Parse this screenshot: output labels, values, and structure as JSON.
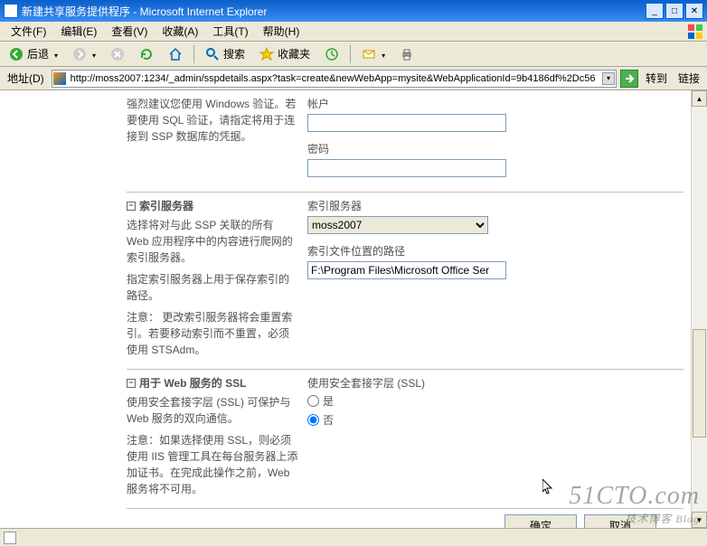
{
  "window": {
    "title": "新建共享服务提供程序 - Microsoft Internet Explorer",
    "min": "_",
    "max": "□",
    "close": "✕"
  },
  "menu": {
    "file": "文件(F)",
    "edit": "编辑(E)",
    "view": "查看(V)",
    "favorites": "收藏(A)",
    "tools": "工具(T)",
    "help": "帮助(H)"
  },
  "toolbar": {
    "back": "后退",
    "forward": "",
    "stop": "",
    "refresh": "",
    "home": "",
    "search": "搜索",
    "favorites": "收藏夹"
  },
  "addressbar": {
    "label": "地址(D)",
    "url": "http://moss2007:1234/_admin/sspdetails.aspx?task=create&newWebApp=mysite&WebApplicationId=9b4186df%2Dc56",
    "go": "转到",
    "links": "链接"
  },
  "sections": {
    "credential": {
      "text1": "强烈建议您使用 Windows 验证。若要使用 SQL 验证，请指定将用于连接到 SSP 数据库的凭据。",
      "field_account": "帐户",
      "field_password": "密码",
      "account_value": "",
      "password_value": ""
    },
    "index": {
      "heading": "索引服务器",
      "text1": "选择将对与此 SSP 关联的所有 Web 应用程序中的内容进行爬网的索引服务器。",
      "text2": "指定索引服务器上用于保存索引的路径。",
      "note": "注意：  更改索引服务器将会重置索引。若要移动索引而不重置，必须使用 STSAdm。",
      "field_server": "索引服务器",
      "server_value": "moss2007",
      "field_path": "索引文件位置的路径",
      "path_value": "F:\\Program Files\\Microsoft Office Ser"
    },
    "ssl": {
      "heading": "用于 Web 服务的 SSL",
      "text1": "使用安全套接字层 (SSL) 可保护与 Web 服务的双向通信。",
      "note": "注意：如果选择使用 SSL，则必须使用 IIS 管理工具在每台服务器上添加证书。在完成此操作之前，Web 服务将不可用。",
      "field_ssl": "使用安全套接字层 (SSL)",
      "opt_yes": "是",
      "opt_no": "否"
    }
  },
  "buttons": {
    "ok": "确定",
    "cancel": "取消"
  },
  "watermark": {
    "main": "51CTO.com",
    "sub": "技术博客   Blog"
  }
}
